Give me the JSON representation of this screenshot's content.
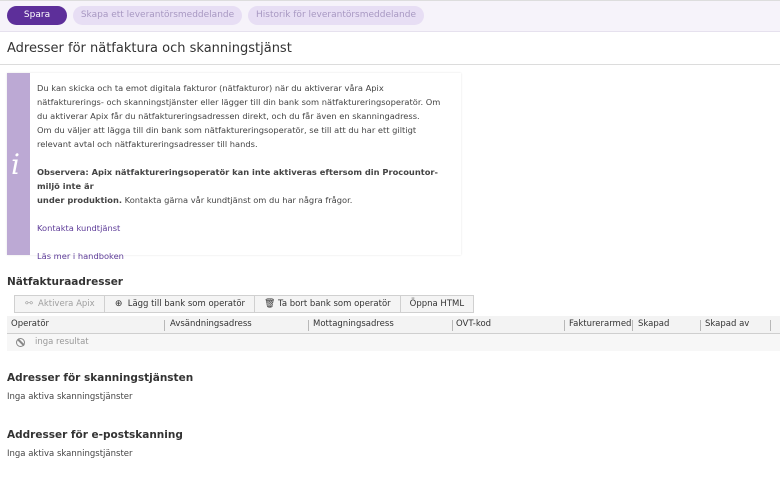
{
  "toolbar": {
    "save": "Spara",
    "create_message": "Skapa ett leverantörsmeddelande",
    "history": "Historik för leverantörsmeddelande"
  },
  "page": {
    "title": "Adresser för nätfaktura och skanningstjänst"
  },
  "info": {
    "icon": "info-icon",
    "paragraph1": [
      "Du kan skicka och ta emot digitala fakturor (nätfakturor) när du aktiverar våra Apix",
      "nätfakturerings- och skanningstjänster eller lägger till din bank som nätfaktureringsoperatör. Om",
      "du aktiverar Apix får du nätfaktureringsadressen direkt, och du får även en skanningadress.",
      "Om du väljer att lägga till din bank som nätfaktureringsoperatör, se till att du har ett giltigt",
      "relevant avtal och nätfaktureringsadresser till hands."
    ],
    "notice_bold_line1": "Observera: Apix nätfaktureringsoperatör kan inte aktiveras eftersom din Procountor-miljö inte är",
    "notice_bold_line2": "under produktion.",
    "notice_rest": " Kontakta gärna vår kundtjänst om du har några frågor.",
    "link_contact": "Kontakta kundtjänst",
    "link_handbook": "Läs mer i handboken"
  },
  "einvoice": {
    "title": "Nätfakturaadresser",
    "buttons": {
      "activate": "Aktivera Apix",
      "add_bank": "Lägg till bank som operatör",
      "remove_bank": "Ta bort bank som operatör",
      "open_html": "Öppna HTML"
    },
    "columns": [
      "Operatör",
      "Avsändningsadress",
      "Mottagningsadress",
      "OVT-kod",
      "Fakturerarmed",
      "Skapad",
      "Skapad av"
    ],
    "empty": "inga resultat"
  },
  "scanning": {
    "title": "Adresser för skanningstjänsten",
    "text": "Inga aktiva skanningstjänster"
  },
  "email_scanning": {
    "title": "Addresser för e-postskanning",
    "text": "Inga aktiva skanningstjänster"
  }
}
